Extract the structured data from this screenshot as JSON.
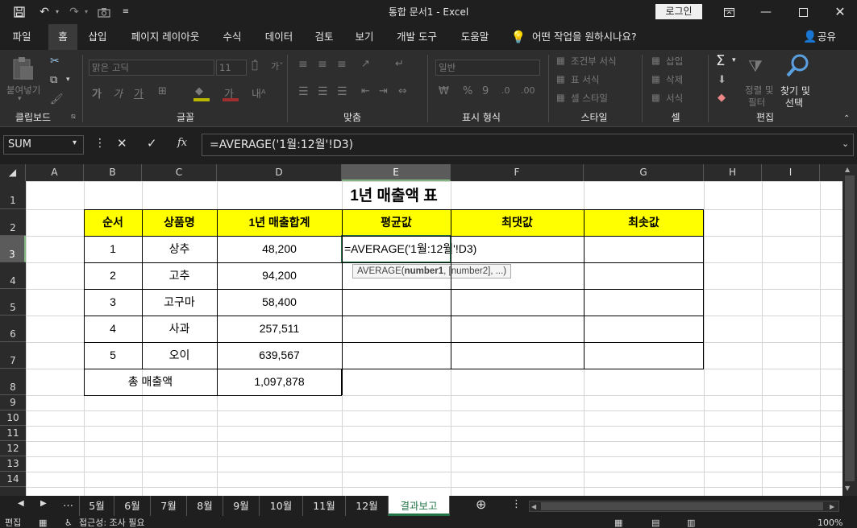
{
  "window": {
    "title": "통합 문서1  -  Excel",
    "login_label": "로그인"
  },
  "ribbon_tabs": [
    "파일",
    "홈",
    "삽입",
    "페이지 레이아웃",
    "수식",
    "데이터",
    "검토",
    "보기",
    "개발 도구",
    "도움말"
  ],
  "tell_me": "어떤 작업을 원하시나요?",
  "share_label": "공유",
  "ribbon": {
    "clipboard": {
      "label": "클립보드",
      "paste": "붙여넣기"
    },
    "font": {
      "label": "글꼴",
      "font_name": "맑은 고딕",
      "font_size": "11"
    },
    "alignment": {
      "label": "맞춤"
    },
    "number": {
      "label": "표시 형식",
      "format": "일반"
    },
    "styles": {
      "label": "스타일",
      "conditional": "조건부 서식",
      "table": "표 서식",
      "cell_styles": "셀 스타일"
    },
    "cells": {
      "label": "셀",
      "insert": "삽입",
      "delete": "삭제",
      "format": "서식"
    },
    "editing": {
      "label": "편집",
      "sort_filter_1": "정렬 및",
      "sort_filter_2": "필터",
      "find_1": "찾기 및",
      "find_2": "선택"
    }
  },
  "formula_bar": {
    "name_box": "SUM",
    "formula": "=AVERAGE('1월:12월'!D3)"
  },
  "columns": [
    "A",
    "B",
    "C",
    "D",
    "E",
    "F",
    "G",
    "H",
    "I"
  ],
  "rows": [
    "1",
    "2",
    "3",
    "4",
    "5",
    "6",
    "7",
    "8",
    "9",
    "10",
    "11",
    "12",
    "13",
    "14"
  ],
  "sheet": {
    "title": "1년 매출액 표",
    "headers": [
      "순서",
      "상품명",
      "1년 매출합계",
      "평균값",
      "최댓값",
      "최솟값"
    ],
    "data_rows": [
      [
        "1",
        "상추",
        "48,200"
      ],
      [
        "2",
        "고추",
        "94,200"
      ],
      [
        "3",
        "고구마",
        "58,400"
      ],
      [
        "4",
        "사과",
        "257,511"
      ],
      [
        "5",
        "오이",
        "639,567"
      ]
    ],
    "total_label": "총 매출액",
    "total_value": "1,097,878",
    "editing_cell": "=AVERAGE('1월:12월'!D3)",
    "tooltip_fn": "AVERAGE(",
    "tooltip_arg1": "number1",
    "tooltip_rest": ", [number2], ...)"
  },
  "sheet_tabs": [
    "5월",
    "6월",
    "7월",
    "8월",
    "9월",
    "10월",
    "11월",
    "12월",
    "결과보고"
  ],
  "status": {
    "mode": "편집",
    "accessibility": "접근성: 조사 필요",
    "zoom": "100%"
  }
}
